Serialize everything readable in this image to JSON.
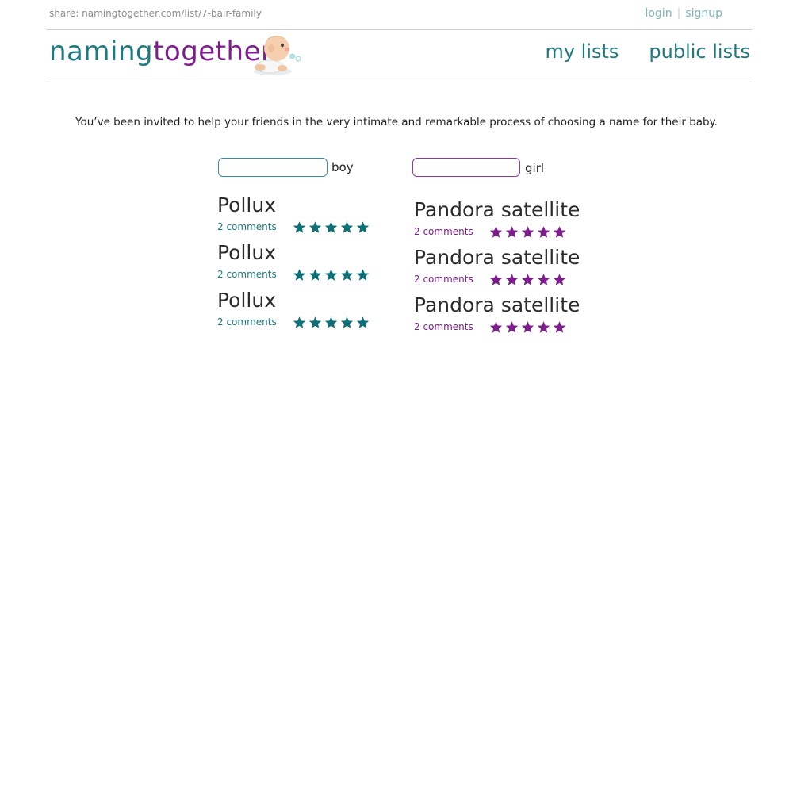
{
  "topbar": {
    "share_text": "share: namingtogether.com/list/7-bair-family",
    "login": "login",
    "signup": "signup"
  },
  "header": {
    "logo_part1": "naming",
    "logo_part2": "together",
    "nav": {
      "my_lists": "my lists",
      "public_lists": "public lists"
    }
  },
  "intro": "You’ve been invited to help your friends in the very intimate and remarkable process of choosing a name for their baby.",
  "boy": {
    "label": "boy",
    "input_value": "",
    "names": [
      {
        "name": "Pollux",
        "comments": "2 comments",
        "rating": 5
      },
      {
        "name": "Pollux",
        "comments": "2 comments",
        "rating": 5
      },
      {
        "name": "Pollux",
        "comments": "2 comments",
        "rating": 5
      }
    ]
  },
  "girl": {
    "label": "girl",
    "input_value": "",
    "names": [
      {
        "name": "Pandora satellite",
        "comments": "2 comments",
        "rating": 5
      },
      {
        "name": "Pandora satellite",
        "comments": "2 comments",
        "rating": 5
      },
      {
        "name": "Pandora satellite",
        "comments": "2 comments",
        "rating": 5
      }
    ]
  },
  "colors": {
    "teal": "#1f7a80",
    "purple": "#7d1e8c",
    "boy_star": "#0f6f78",
    "girl_star": "#7d1e8c"
  }
}
